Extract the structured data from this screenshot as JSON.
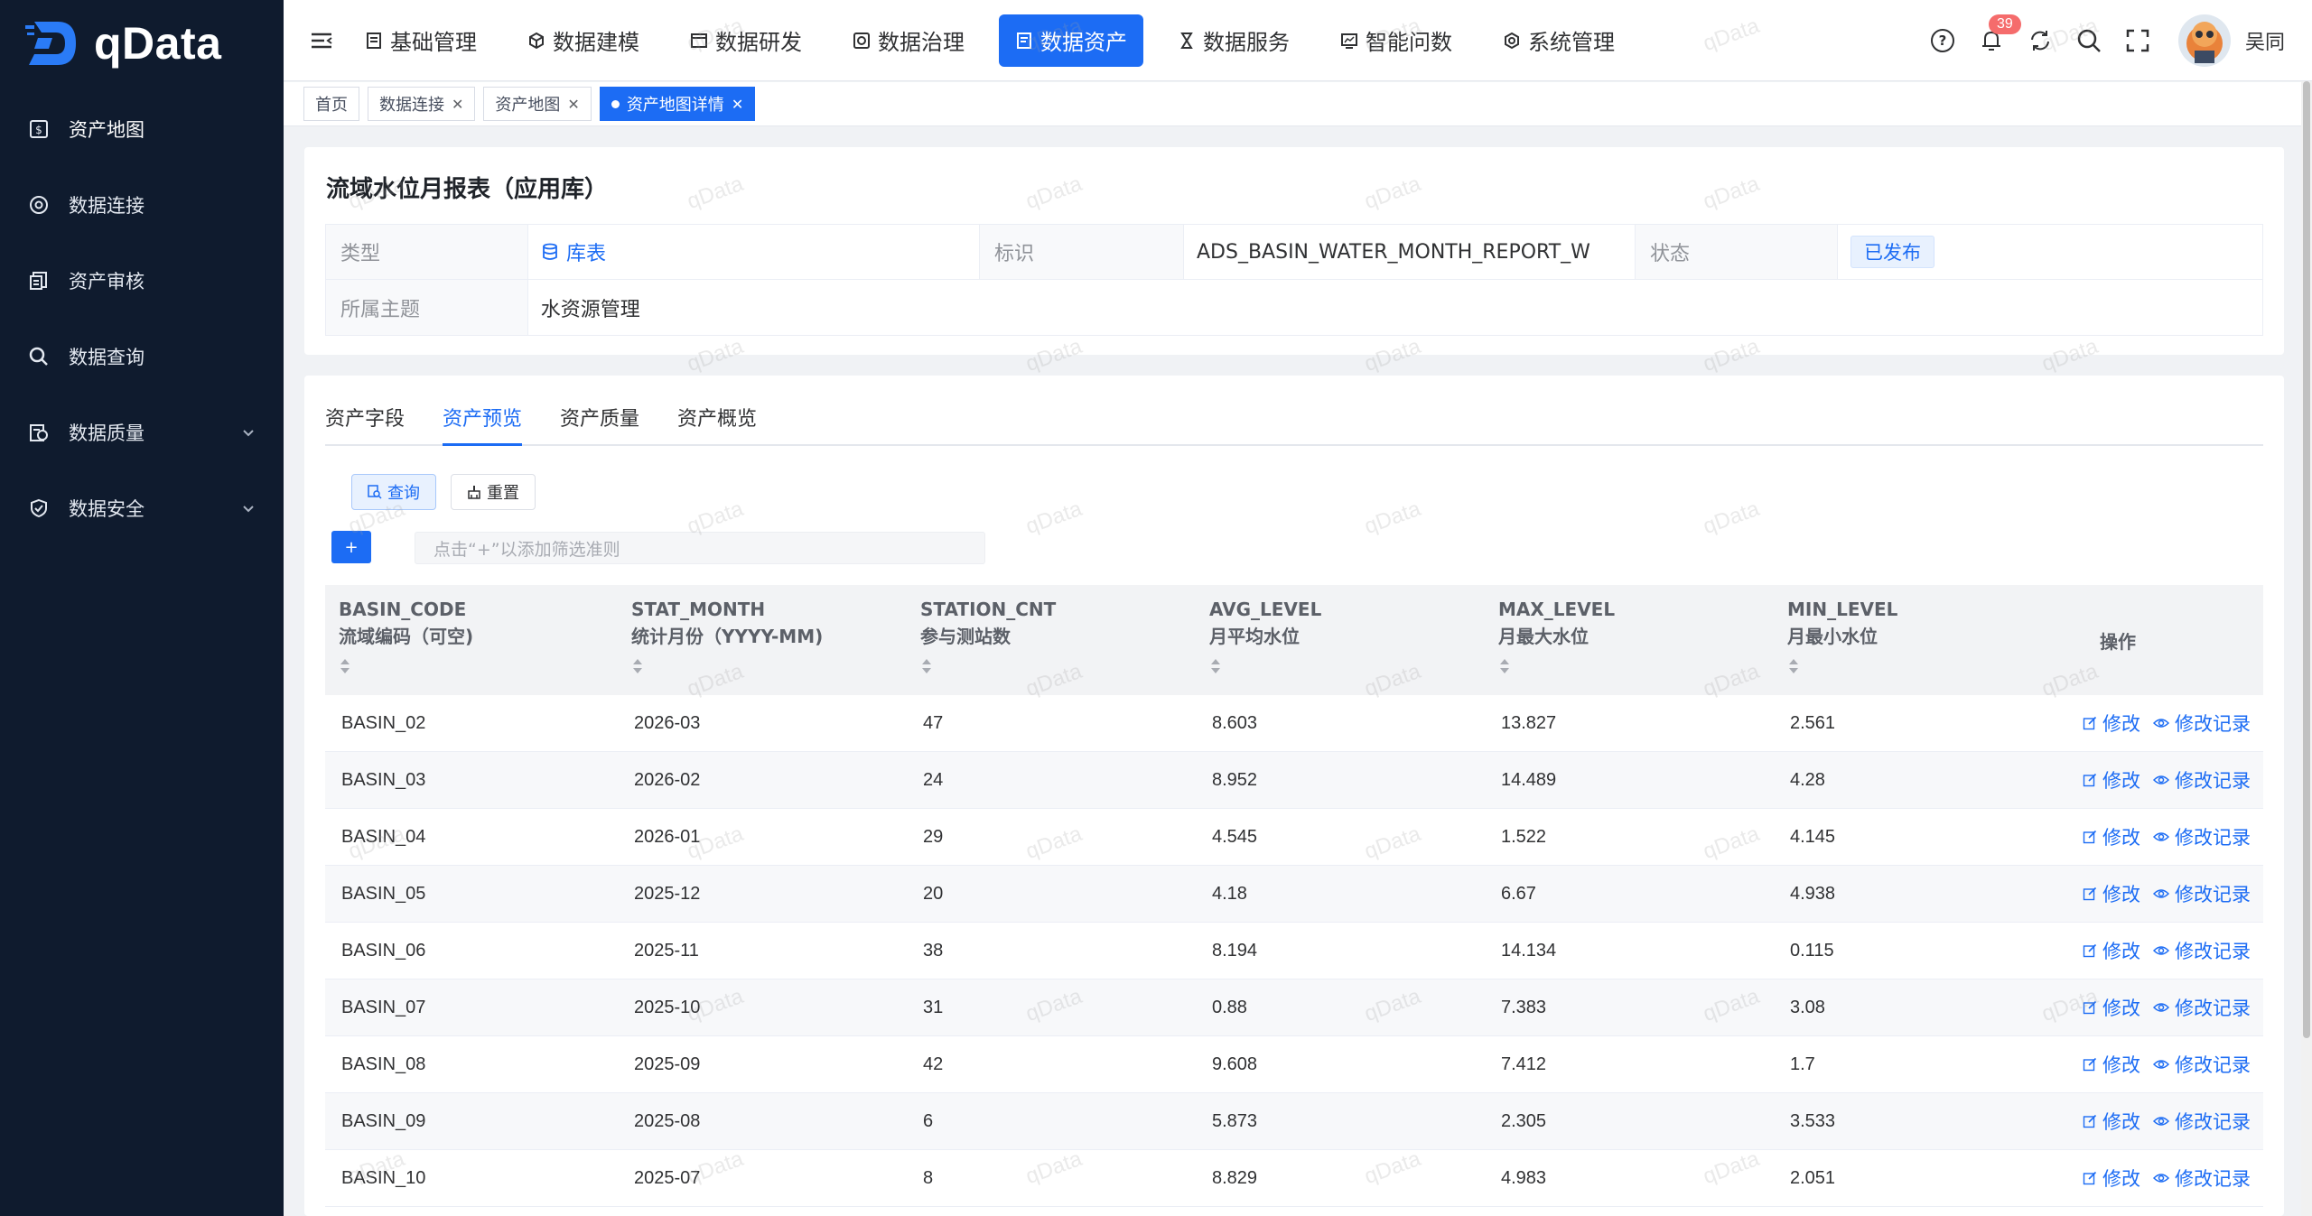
{
  "app": {
    "name": "qData"
  },
  "sidebar": {
    "items": [
      {
        "label": "资产地图",
        "icon": "asset-map-icon",
        "active": true,
        "expandable": false
      },
      {
        "label": "数据连接",
        "icon": "connection-icon",
        "active": false,
        "expandable": false
      },
      {
        "label": "资产审核",
        "icon": "audit-icon",
        "active": false,
        "expandable": false
      },
      {
        "label": "数据查询",
        "icon": "search-icon",
        "active": false,
        "expandable": false
      },
      {
        "label": "数据质量",
        "icon": "quality-icon",
        "active": false,
        "expandable": true
      },
      {
        "label": "数据安全",
        "icon": "shield-icon",
        "active": false,
        "expandable": true
      }
    ]
  },
  "header": {
    "nav": [
      {
        "label": "基础管理",
        "icon": "doc-icon",
        "active": false
      },
      {
        "label": "数据建模",
        "icon": "cube-icon",
        "active": false
      },
      {
        "label": "数据研发",
        "icon": "window-icon",
        "active": false
      },
      {
        "label": "数据治理",
        "icon": "govern-icon",
        "active": false
      },
      {
        "label": "数据资产",
        "icon": "asset-icon",
        "active": true
      },
      {
        "label": "数据服务",
        "icon": "hourglass-icon",
        "active": false
      },
      {
        "label": "智能问数",
        "icon": "monitor-icon",
        "active": false
      },
      {
        "label": "系统管理",
        "icon": "settings-icon",
        "active": false
      }
    ],
    "notification_count": "39",
    "username": "吴同"
  },
  "tags": [
    {
      "label": "首页",
      "closable": false,
      "active": false
    },
    {
      "label": "数据连接",
      "closable": true,
      "active": false
    },
    {
      "label": "资产地图",
      "closable": true,
      "active": false
    },
    {
      "label": "资产地图详情",
      "closable": true,
      "active": true
    }
  ],
  "detail": {
    "title": "流域水位月报表（应用库）",
    "type_label": "类型",
    "type_value": "库表",
    "id_label": "标识",
    "id_value": "ADS_BASIN_WATER_MONTH_REPORT_W",
    "status_label": "状态",
    "status_value": "已发布",
    "theme_label": "所属主题",
    "theme_value": "水资源管理"
  },
  "tabs": [
    {
      "label": "资产字段",
      "active": false
    },
    {
      "label": "资产预览",
      "active": true
    },
    {
      "label": "资产质量",
      "active": false
    },
    {
      "label": "资产概览",
      "active": false
    }
  ],
  "toolbar": {
    "query_label": "查询",
    "reset_label": "重置",
    "add_label": "+",
    "filter_placeholder": "点击“+”以添加筛选准则"
  },
  "table": {
    "columns": [
      {
        "en": "BASIN_CODE",
        "zh": "流域编码（可空)"
      },
      {
        "en": "STAT_MONTH",
        "zh": "统计月份（YYYY-MM)"
      },
      {
        "en": "STATION_CNT",
        "zh": "参与测站数"
      },
      {
        "en": "AVG_LEVEL",
        "zh": "月平均水位"
      },
      {
        "en": "MAX_LEVEL",
        "zh": "月最大水位"
      },
      {
        "en": "MIN_LEVEL",
        "zh": "月最小水位"
      }
    ],
    "ops_header": "操作",
    "edit_label": "修改",
    "history_label": "修改记录",
    "rows": [
      [
        "BASIN_02",
        "2026-03",
        "47",
        "8.603",
        "13.827",
        "2.561"
      ],
      [
        "BASIN_03",
        "2026-02",
        "24",
        "8.952",
        "14.489",
        "4.28"
      ],
      [
        "BASIN_04",
        "2026-01",
        "29",
        "4.545",
        "1.522",
        "4.145"
      ],
      [
        "BASIN_05",
        "2025-12",
        "20",
        "4.18",
        "6.67",
        "4.938"
      ],
      [
        "BASIN_06",
        "2025-11",
        "38",
        "8.194",
        "14.134",
        "0.115"
      ],
      [
        "BASIN_07",
        "2025-10",
        "31",
        "0.88",
        "7.383",
        "3.08"
      ],
      [
        "BASIN_08",
        "2025-09",
        "42",
        "9.608",
        "7.412",
        "1.7"
      ],
      [
        "BASIN_09",
        "2025-08",
        "6",
        "5.873",
        "2.305",
        "3.533"
      ],
      [
        "BASIN_10",
        "2025-07",
        "8",
        "8.829",
        "4.983",
        "2.051"
      ]
    ]
  },
  "watermark": "qData",
  "colors": {
    "sidebar_bg": "#0f1b2e",
    "accent": "#1c6cf4",
    "badge": "#f56c6c"
  }
}
